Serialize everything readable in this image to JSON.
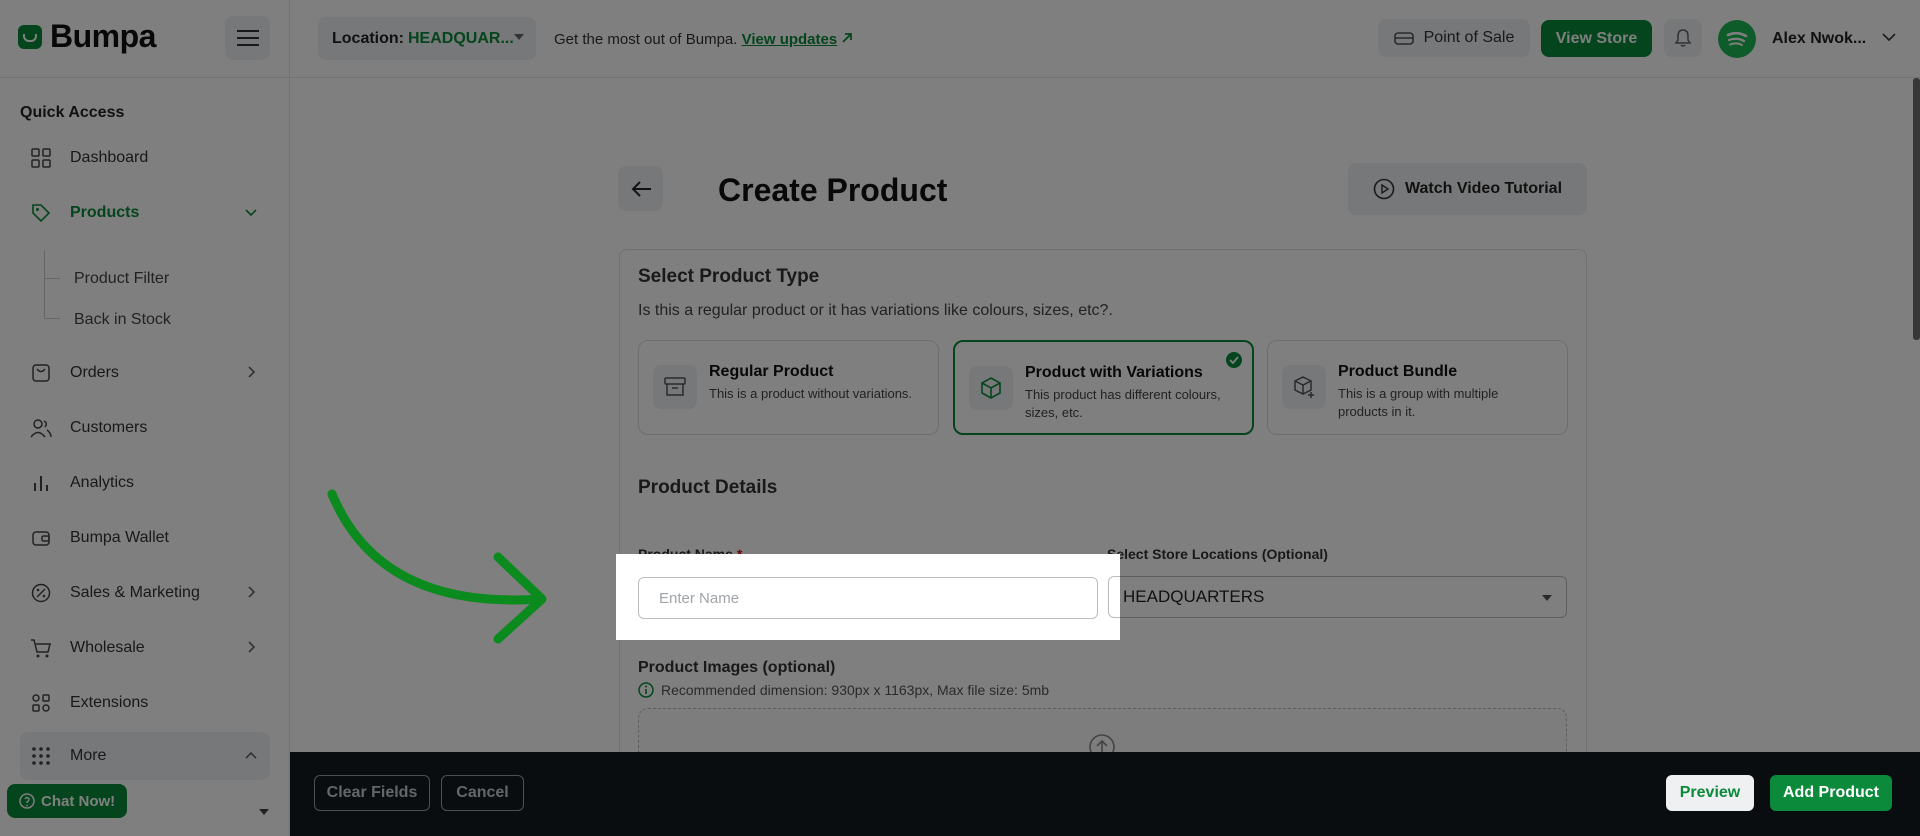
{
  "header": {
    "brand": "Bumpa",
    "location_label": "Location:",
    "location_value": "HEADQUAR...",
    "updates_text": "Get the most out of Bumpa.",
    "updates_link": "View updates",
    "pos_label": "Point of Sale",
    "view_store_label": "View Store",
    "user_name": "Alex Nwok..."
  },
  "sidebar": {
    "section_title": "Quick Access",
    "items": [
      {
        "label": "Dashboard",
        "icon": "grid-icon"
      },
      {
        "label": "Products",
        "icon": "tag-icon",
        "active": true
      },
      {
        "label": "Orders",
        "icon": "bag-icon"
      },
      {
        "label": "Customers",
        "icon": "users-icon"
      },
      {
        "label": "Analytics",
        "icon": "bar-chart-icon"
      },
      {
        "label": "Bumpa Wallet",
        "icon": "wallet-icon"
      },
      {
        "label": "Sales & Marketing",
        "icon": "percent-icon"
      },
      {
        "label": "Wholesale",
        "icon": "cart-icon"
      },
      {
        "label": "Extensions",
        "icon": "puzzle-icon"
      },
      {
        "label": "More",
        "icon": "dots-grid-icon"
      }
    ],
    "sub_items": [
      "Product Filter",
      "Back in Stock"
    ],
    "chat_label": "Chat Now!"
  },
  "main": {
    "title": "Create Product",
    "tutorial_label": "Watch Video Tutorial",
    "type_section": {
      "title": "Select Product Type",
      "subtitle": "Is this a regular product or it has variations like colours, sizes, etc?.",
      "types": [
        {
          "title": "Regular Product",
          "desc": "This is a product without variations.",
          "icon": "archive-box-icon"
        },
        {
          "title": "Product with Variations",
          "desc": "This product has different colours, sizes, etc.",
          "icon": "cube-icon",
          "selected": true
        },
        {
          "title": "Product Bundle",
          "desc": "This is a group with multiple products in it.",
          "icon": "bundle-icon"
        }
      ]
    },
    "details": {
      "title": "Product Details",
      "name_label": "Product Name",
      "name_required": "*",
      "name_placeholder": "Enter Name",
      "locations_label": "Select Store Locations (Optional)",
      "locations_value": "HEADQUARTERS",
      "images_label": "Product Images (optional)",
      "images_hint": "Recommended dimension: 930px x 1163px, Max file size: 5mb"
    }
  },
  "footer": {
    "clear_label": "Clear Fields",
    "cancel_label": "Cancel",
    "preview_label": "Preview",
    "add_label": "Add Product"
  },
  "colors": {
    "brand_green": "#0a8a3a",
    "footer_dark": "#141a1f",
    "overlay": "rgba(0,0,0,0.5)"
  }
}
